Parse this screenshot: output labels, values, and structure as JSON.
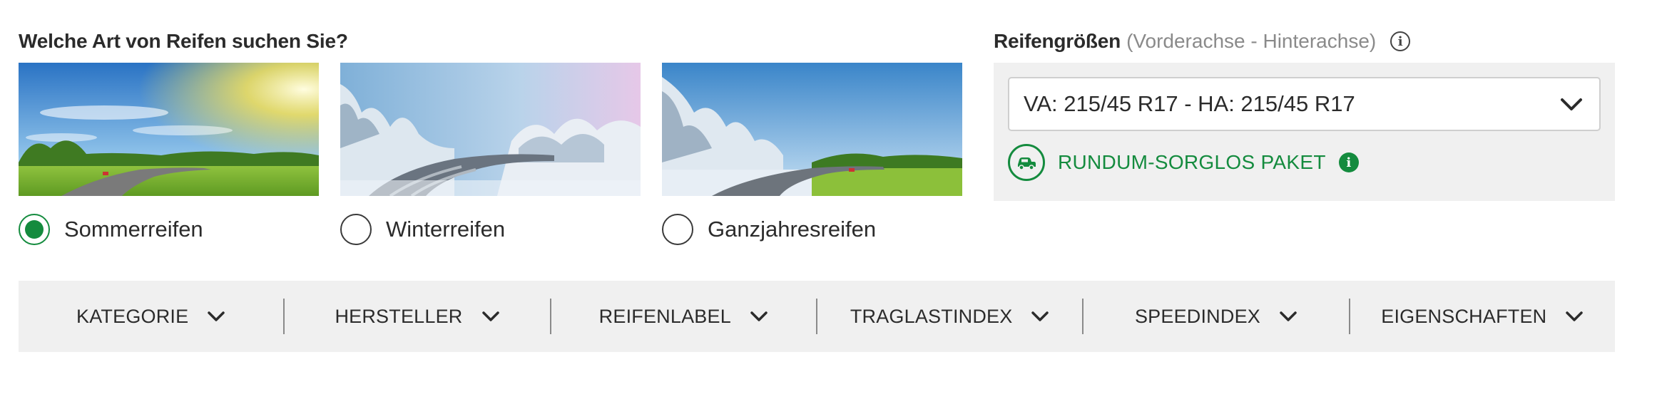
{
  "tire_types": {
    "title": "Welche Art von Reifen suchen Sie?",
    "options": [
      {
        "label": "Sommerreifen",
        "selected": true
      },
      {
        "label": "Winterreifen",
        "selected": false
      },
      {
        "label": "Ganzjahresreifen",
        "selected": false
      }
    ]
  },
  "tire_sizes": {
    "title": "Reifengrößen",
    "subtitle": "(Vorderachse - Hinterachse)",
    "selected_value": "VA: 215/45 R17 - HA: 215/45 R17",
    "package_label": "RUNDUM-SORGLOS PAKET"
  },
  "filters": [
    "KATEGORIE",
    "HERSTELLER",
    "REIFENLABEL",
    "TRAGLASTINDEX",
    "SPEEDINDEX",
    "EIGENSCHAFTEN"
  ],
  "colors": {
    "accent": "#148b3e",
    "panel_bg": "#f0f0f0",
    "text": "#2b2b2b",
    "muted": "#8a8a8a"
  },
  "icons": {
    "info_outline": "info-circle-outline-icon",
    "info_filled": "info-circle-filled-icon",
    "package": "car-service-icon",
    "dropdown": "chevron-down-icon"
  }
}
